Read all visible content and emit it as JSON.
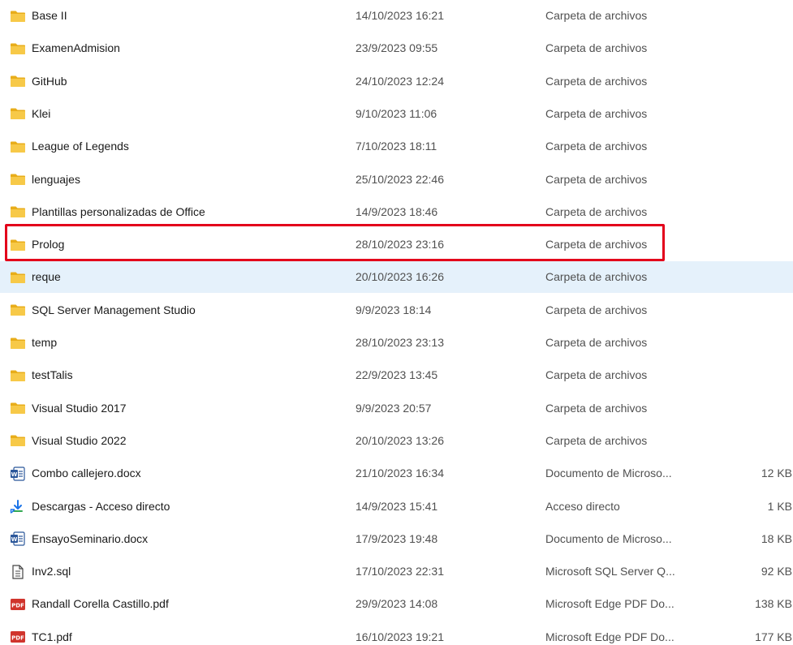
{
  "colors": {
    "folder": "#f7c948",
    "folder_dark": "#e8ad1a",
    "hover_row": "#e5f1fb",
    "highlight_box": "#e3001b",
    "word_blue": "#2b579a",
    "pdf_red": "#d0342c",
    "shortcut_green": "#32a852",
    "shortcut_blue": "#1a73e8"
  },
  "files": [
    {
      "name": "Base II",
      "date": "14/10/2023 16:21",
      "type": "Carpeta de archivos",
      "size": "",
      "icon": "folder-icon"
    },
    {
      "name": "ExamenAdmision",
      "date": "23/9/2023 09:55",
      "type": "Carpeta de archivos",
      "size": "",
      "icon": "folder-icon"
    },
    {
      "name": "GitHub",
      "date": "24/10/2023 12:24",
      "type": "Carpeta de archivos",
      "size": "",
      "icon": "folder-icon"
    },
    {
      "name": "Klei",
      "date": "9/10/2023 11:06",
      "type": "Carpeta de archivos",
      "size": "",
      "icon": "folder-icon"
    },
    {
      "name": "League of Legends",
      "date": "7/10/2023 18:11",
      "type": "Carpeta de archivos",
      "size": "",
      "icon": "folder-icon"
    },
    {
      "name": "lenguajes",
      "date": "25/10/2023 22:46",
      "type": "Carpeta de archivos",
      "size": "",
      "icon": "folder-icon"
    },
    {
      "name": "Plantillas personalizadas de Office",
      "date": "14/9/2023 18:46",
      "type": "Carpeta de archivos",
      "size": "",
      "icon": "folder-icon"
    },
    {
      "name": "Prolog",
      "date": "28/10/2023 23:16",
      "type": "Carpeta de archivos",
      "size": "",
      "icon": "folder-icon"
    },
    {
      "name": "reque",
      "date": "20/10/2023 16:26",
      "type": "Carpeta de archivos",
      "size": "",
      "icon": "folder-icon"
    },
    {
      "name": "SQL Server Management Studio",
      "date": "9/9/2023 18:14",
      "type": "Carpeta de archivos",
      "size": "",
      "icon": "folder-icon"
    },
    {
      "name": "temp",
      "date": "28/10/2023 23:13",
      "type": "Carpeta de archivos",
      "size": "",
      "icon": "folder-icon"
    },
    {
      "name": "testTalis",
      "date": "22/9/2023 13:45",
      "type": "Carpeta de archivos",
      "size": "",
      "icon": "folder-icon"
    },
    {
      "name": "Visual Studio 2017",
      "date": "9/9/2023 20:57",
      "type": "Carpeta de archivos",
      "size": "",
      "icon": "folder-icon"
    },
    {
      "name": "Visual Studio 2022",
      "date": "20/10/2023 13:26",
      "type": "Carpeta de archivos",
      "size": "",
      "icon": "folder-icon"
    },
    {
      "name": "Combo callejero.docx",
      "date": "21/10/2023 16:34",
      "type": "Documento de Microso...",
      "size": "12 KB",
      "icon": "word-document-icon"
    },
    {
      "name": "Descargas - Acceso directo",
      "date": "14/9/2023 15:41",
      "type": "Acceso directo",
      "size": "1 KB",
      "icon": "shortcut-icon"
    },
    {
      "name": "EnsayoSeminario.docx",
      "date": "17/9/2023 19:48",
      "type": "Documento de Microso...",
      "size": "18 KB",
      "icon": "word-document-icon"
    },
    {
      "name": "Inv2.sql",
      "date": "17/10/2023 22:31",
      "type": "Microsoft SQL Server Q...",
      "size": "92 KB",
      "icon": "text-file-icon"
    },
    {
      "name": "Randall Corella Castillo.pdf",
      "date": "29/9/2023 14:08",
      "type": "Microsoft Edge PDF Do...",
      "size": "138 KB",
      "icon": "pdf-icon"
    },
    {
      "name": "TC1.pdf",
      "date": "16/10/2023 19:21",
      "type": "Microsoft Edge PDF Do...",
      "size": "177 KB",
      "icon": "pdf-icon"
    }
  ]
}
